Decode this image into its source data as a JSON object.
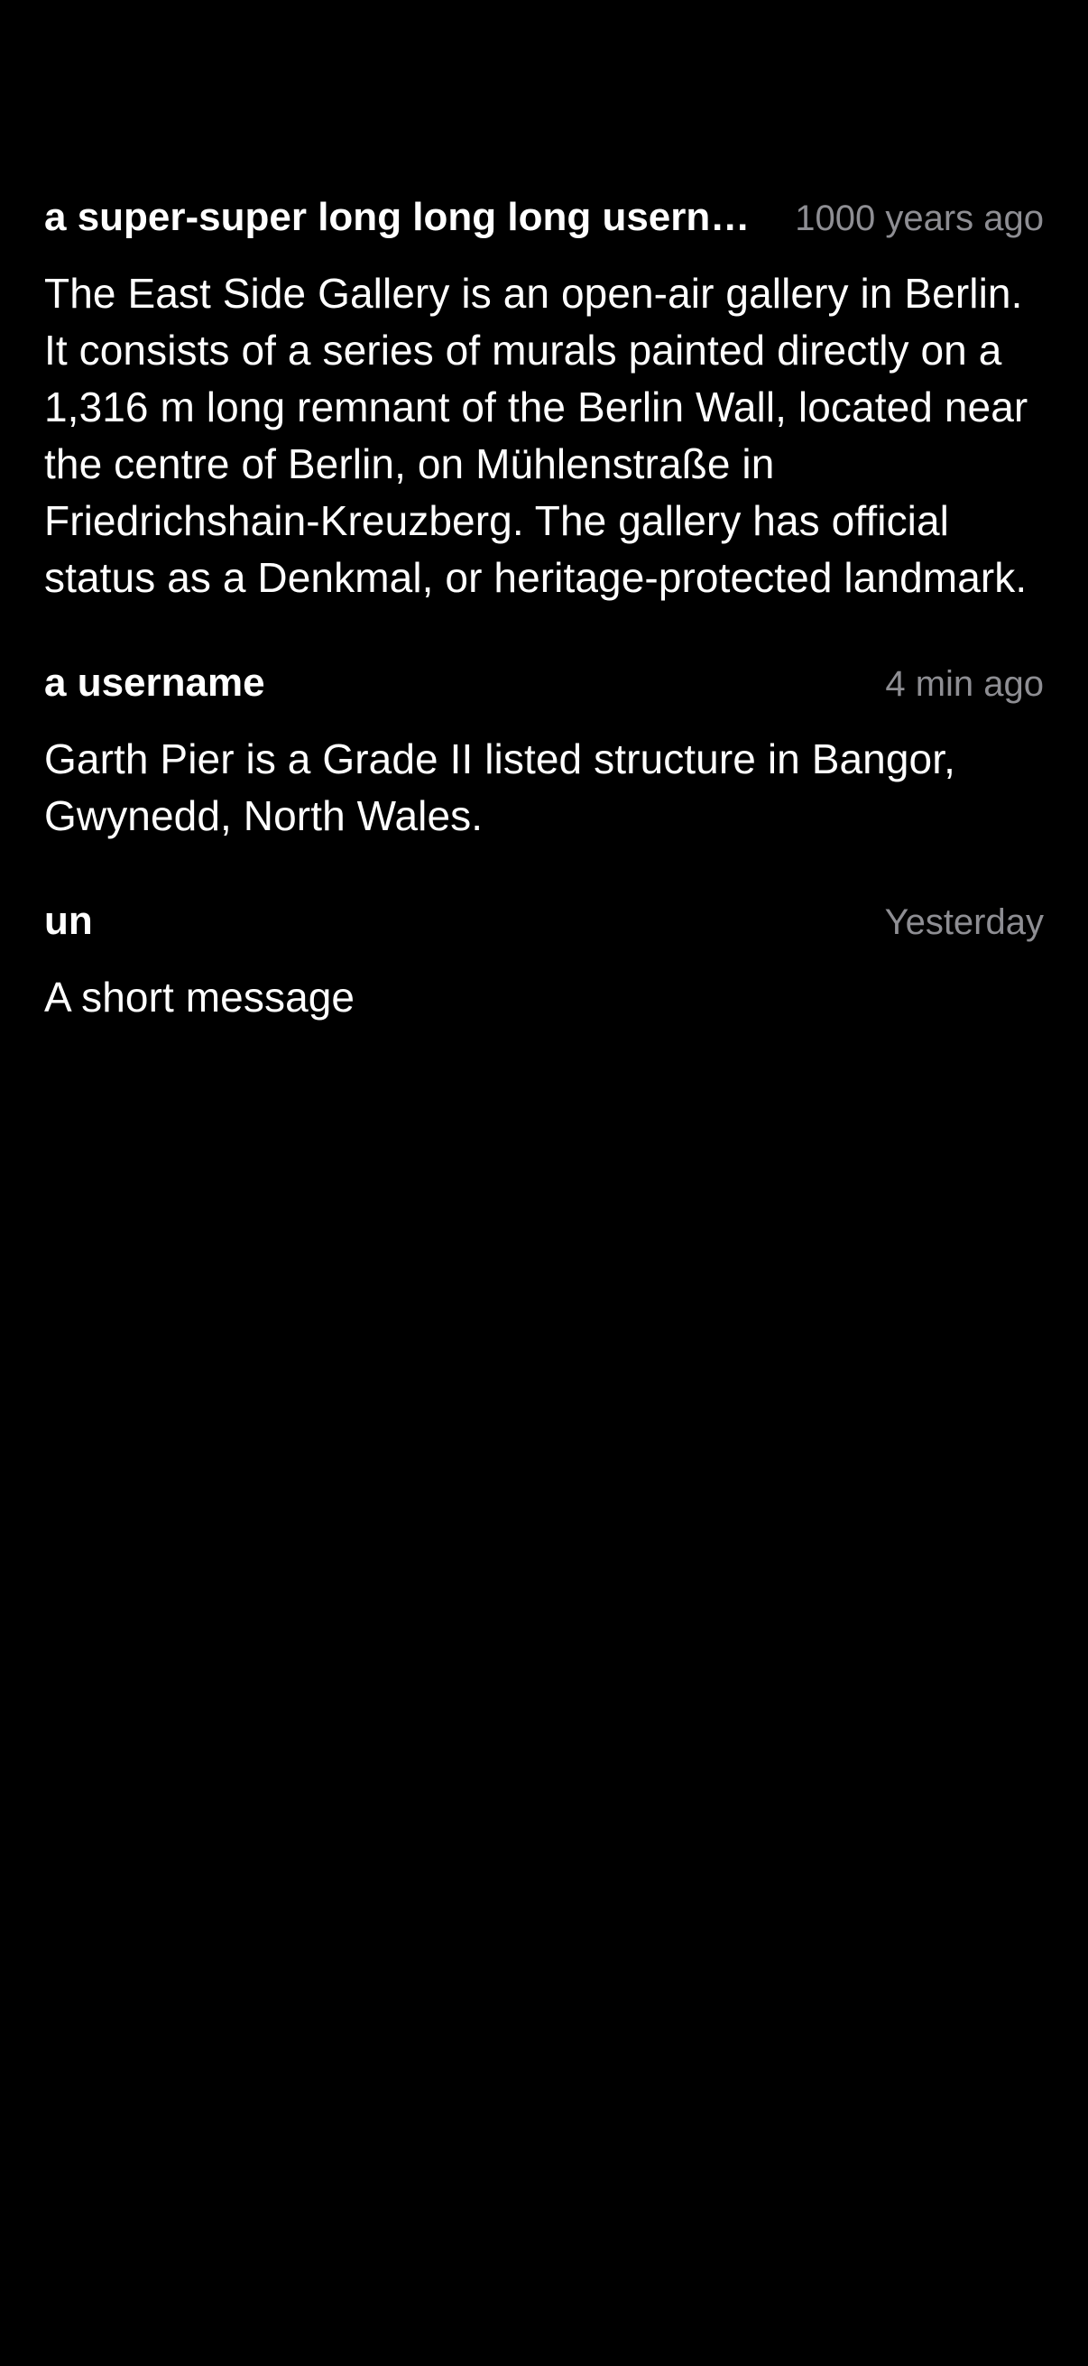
{
  "messages": [
    {
      "username": "a super-super long long long username that gets truncated",
      "timestamp": "1000 years ago",
      "body": "The East Side Gallery is an open-air gallery in Berlin. It consists of a series of murals painted directly on a 1,316 m long remnant of the Berlin Wall, located near the centre of Berlin, on Mühlenstraße in Friedrichshain-Kreuzberg. The gallery has official status as a Denkmal, or heritage-protected landmark."
    },
    {
      "username": "a username",
      "timestamp": "4 min ago",
      "body": "Garth Pier is a Grade II listed structure in Bangor, Gwynedd, North Wales."
    },
    {
      "username": "un",
      "timestamp": "Yesterday",
      "body": "A short message"
    }
  ],
  "colors": {
    "background": "#000000",
    "primary_text": "#ffffff",
    "secondary_text": "#8e8e93"
  }
}
